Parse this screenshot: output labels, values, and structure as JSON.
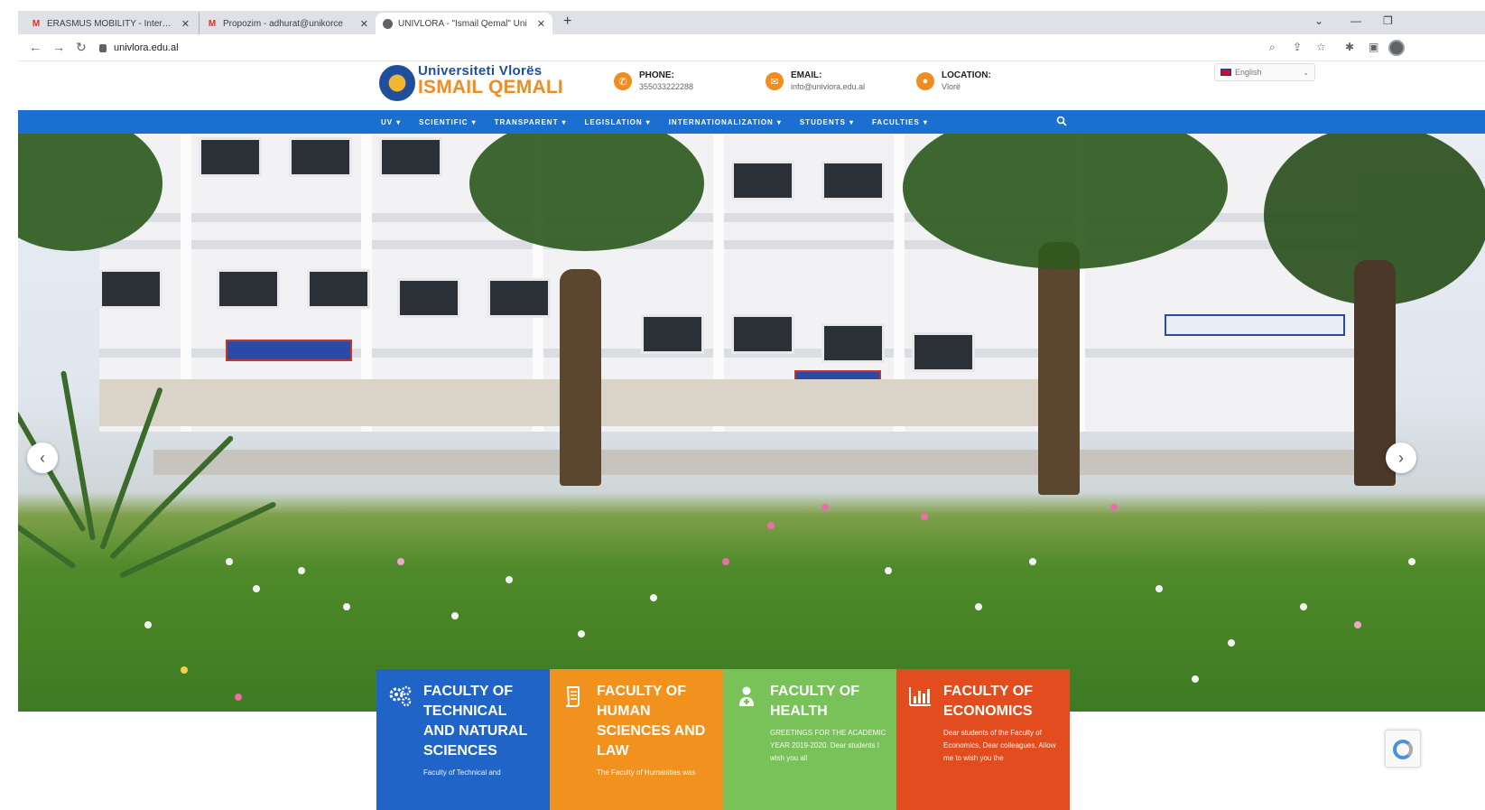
{
  "browser": {
    "tabs": [
      {
        "title": "ERASMUS MOBILITY - Internatio",
        "favicon": "gmail-icon"
      },
      {
        "title": "Propozim - adhurat@unikorce",
        "favicon": "gmail-icon"
      },
      {
        "title": "UNIVLORA - \"Ismail Qemal\" Uni",
        "favicon": "globe-icon",
        "active": true
      }
    ],
    "url": "univlora.edu.al"
  },
  "header": {
    "logo_top": "Universiteti Vlorës",
    "logo_bottom": "ISMAIL QEMALI",
    "phone_label": "PHONE:",
    "phone_value": "355033222288",
    "email_label": "EMAIL:",
    "email_value": "info@univlora.edu.al",
    "location_label": "LOCATION:",
    "location_value": "Vlorë",
    "language": "English"
  },
  "nav": {
    "items": [
      "UV",
      "SCIENTIFIC",
      "TRANSPARENT",
      "LEGISLATION",
      "INTERNATIONALIZATION",
      "STUDENTS",
      "FACULTIES"
    ]
  },
  "faculties": [
    {
      "title": "Faculty of Technical and Natural Sciences",
      "desc": "Faculty of Technical and",
      "color": "#1f64c6",
      "icon": "gears-icon"
    },
    {
      "title": "Faculty of Human Sciences and Law",
      "desc": "The Faculty of Humanities was",
      "color": "#f2921e",
      "icon": "scroll-icon"
    },
    {
      "title": "Faculty of Health",
      "desc": "GREETINGS FOR THE ACADEMIC YEAR 2019-2020. Dear students I wish you all",
      "color": "#79c25a",
      "icon": "nurse-icon"
    },
    {
      "title": "Faculty of Economics",
      "desc": "Dear students of the Faculty of Economics, Dear colleagues, Allow me to wish you the",
      "color": "#e24d1f",
      "icon": "bar-chart-icon"
    }
  ]
}
